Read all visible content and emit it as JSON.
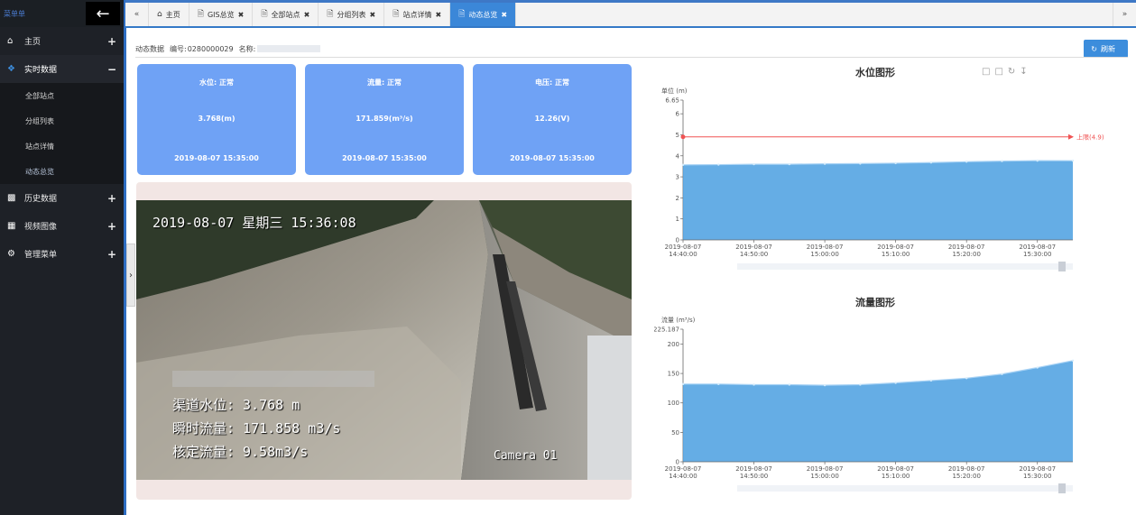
{
  "sidebar": {
    "brand": "菜单单",
    "back_icon": "arrow-left-icon",
    "items": [
      {
        "label": "主页",
        "icon": "home-icon",
        "toggle": "+"
      },
      {
        "label": "实时数据",
        "icon": "cubes-icon",
        "toggle": "−"
      },
      {
        "label": "历史数据",
        "icon": "bar-chart-icon",
        "toggle": "+"
      },
      {
        "label": "视频图像",
        "icon": "film-icon",
        "toggle": "+"
      },
      {
        "label": "管理菜单",
        "icon": "gears-icon",
        "toggle": "+"
      }
    ],
    "sub_items": [
      {
        "label": "全部站点"
      },
      {
        "label": "分组列表"
      },
      {
        "label": "站点详情"
      },
      {
        "label": "动态总览"
      }
    ]
  },
  "tabs": {
    "first_icon": "double-left-icon",
    "last_icon": "double-right-icon",
    "items": [
      {
        "label": "主页",
        "icon": "home-icon",
        "closable": false,
        "active": false
      },
      {
        "label": "GIS总览",
        "icon": "file-icon",
        "closable": true,
        "active": false
      },
      {
        "label": "全部站点",
        "icon": "file-icon",
        "closable": true,
        "active": false
      },
      {
        "label": "分组列表",
        "icon": "file-icon",
        "closable": true,
        "active": false
      },
      {
        "label": "站点详情",
        "icon": "file-icon",
        "closable": true,
        "active": false
      },
      {
        "label": "动态总览",
        "icon": "file-icon",
        "closable": true,
        "active": true
      }
    ],
    "close_glyph": "✖"
  },
  "header": {
    "section": "动态数据",
    "id_label": "编号:",
    "id_value": "0280000029",
    "name_label": "名称:",
    "refresh_label": "刷新"
  },
  "cards": [
    {
      "title": "水位:  正常",
      "value": "3.768(m)",
      "time": "2019-08-07 15:35:00"
    },
    {
      "title": "流量:  正常",
      "value": "171.859(m³/s)",
      "time": "2019-08-07 15:35:00"
    },
    {
      "title": "电压:  正常",
      "value": "12.26(V)",
      "time": "2019-08-07 15:35:00"
    }
  ],
  "camera": {
    "timestamp": "2019-08-07 星期三 15:36:08",
    "line1": "渠道水位: 3.768 m",
    "line2": "瞬时流量: 171.858 m3/s",
    "line3": "核定流量: 9.58m3/s",
    "label": "Camera 01"
  },
  "chart_data": [
    {
      "type": "area",
      "title": "水位图形",
      "ylabel": "单位 (m)",
      "ylim": [
        0,
        6.65
      ],
      "yticks": [
        "6.65",
        "6",
        "5",
        "4",
        "3",
        "2",
        "1",
        "0"
      ],
      "x": [
        "2019-08-07 14:40:00",
        "2019-08-07 14:50:00",
        "2019-08-07 15:00:00",
        "2019-08-07 15:10:00",
        "2019-08-07 15:20:00",
        "2019-08-07 15:30:00"
      ],
      "x_tick_dates": [
        "2019-08-07",
        "2019-08-07",
        "2019-08-07",
        "2019-08-07",
        "2019-08-07",
        "2019-08-07"
      ],
      "x_tick_times": [
        "14:40:00",
        "14:50:00",
        "15:00:00",
        "15:10:00",
        "15:20:00",
        "15:30:00"
      ],
      "series": [
        {
          "values": [
            3.57,
            3.58,
            3.6,
            3.6,
            3.62,
            3.63,
            3.65,
            3.68,
            3.72,
            3.75,
            3.77,
            3.768
          ]
        }
      ],
      "series_x_times": [
        "14:40",
        "14:45",
        "14:50",
        "14:55",
        "15:00",
        "15:05",
        "15:10",
        "15:15",
        "15:20",
        "15:25",
        "15:30",
        "15:35"
      ],
      "markline": {
        "value": 4.9,
        "label": "上限(4.9)"
      },
      "color": "#4a9fe0",
      "markline_color": "#f05454",
      "tools": [
        "zoom-icon",
        "zoom-reset-icon",
        "restore-icon",
        "download-icon"
      ]
    },
    {
      "type": "area",
      "title": "流量图形",
      "ylabel": "流量 (m³/s)",
      "ylim": [
        0,
        225.187
      ],
      "yticks": [
        "225.187",
        "200",
        "150",
        "100",
        "50",
        "0"
      ],
      "x": [
        "2019-08-07 14:40:00",
        "2019-08-07 14:50:00",
        "2019-08-07 15:00:00",
        "2019-08-07 15:10:00",
        "2019-08-07 15:20:00",
        "2019-08-07 15:30:00"
      ],
      "x_tick_dates": [
        "2019-08-07",
        "2019-08-07",
        "2019-08-07",
        "2019-08-07",
        "2019-08-07",
        "2019-08-07"
      ],
      "x_tick_times": [
        "14:40:00",
        "14:50:00",
        "15:00:00",
        "15:10:00",
        "15:20:00",
        "15:30:00"
      ],
      "series": [
        {
          "values": [
            132,
            132,
            131,
            131,
            130,
            131,
            134,
            138,
            142,
            149,
            160,
            171.859
          ]
        }
      ],
      "series_x_times": [
        "14:40",
        "14:45",
        "14:50",
        "14:55",
        "15:00",
        "15:05",
        "15:10",
        "15:15",
        "15:20",
        "15:25",
        "15:30",
        "15:35"
      ],
      "color": "#4a9fe0"
    }
  ]
}
